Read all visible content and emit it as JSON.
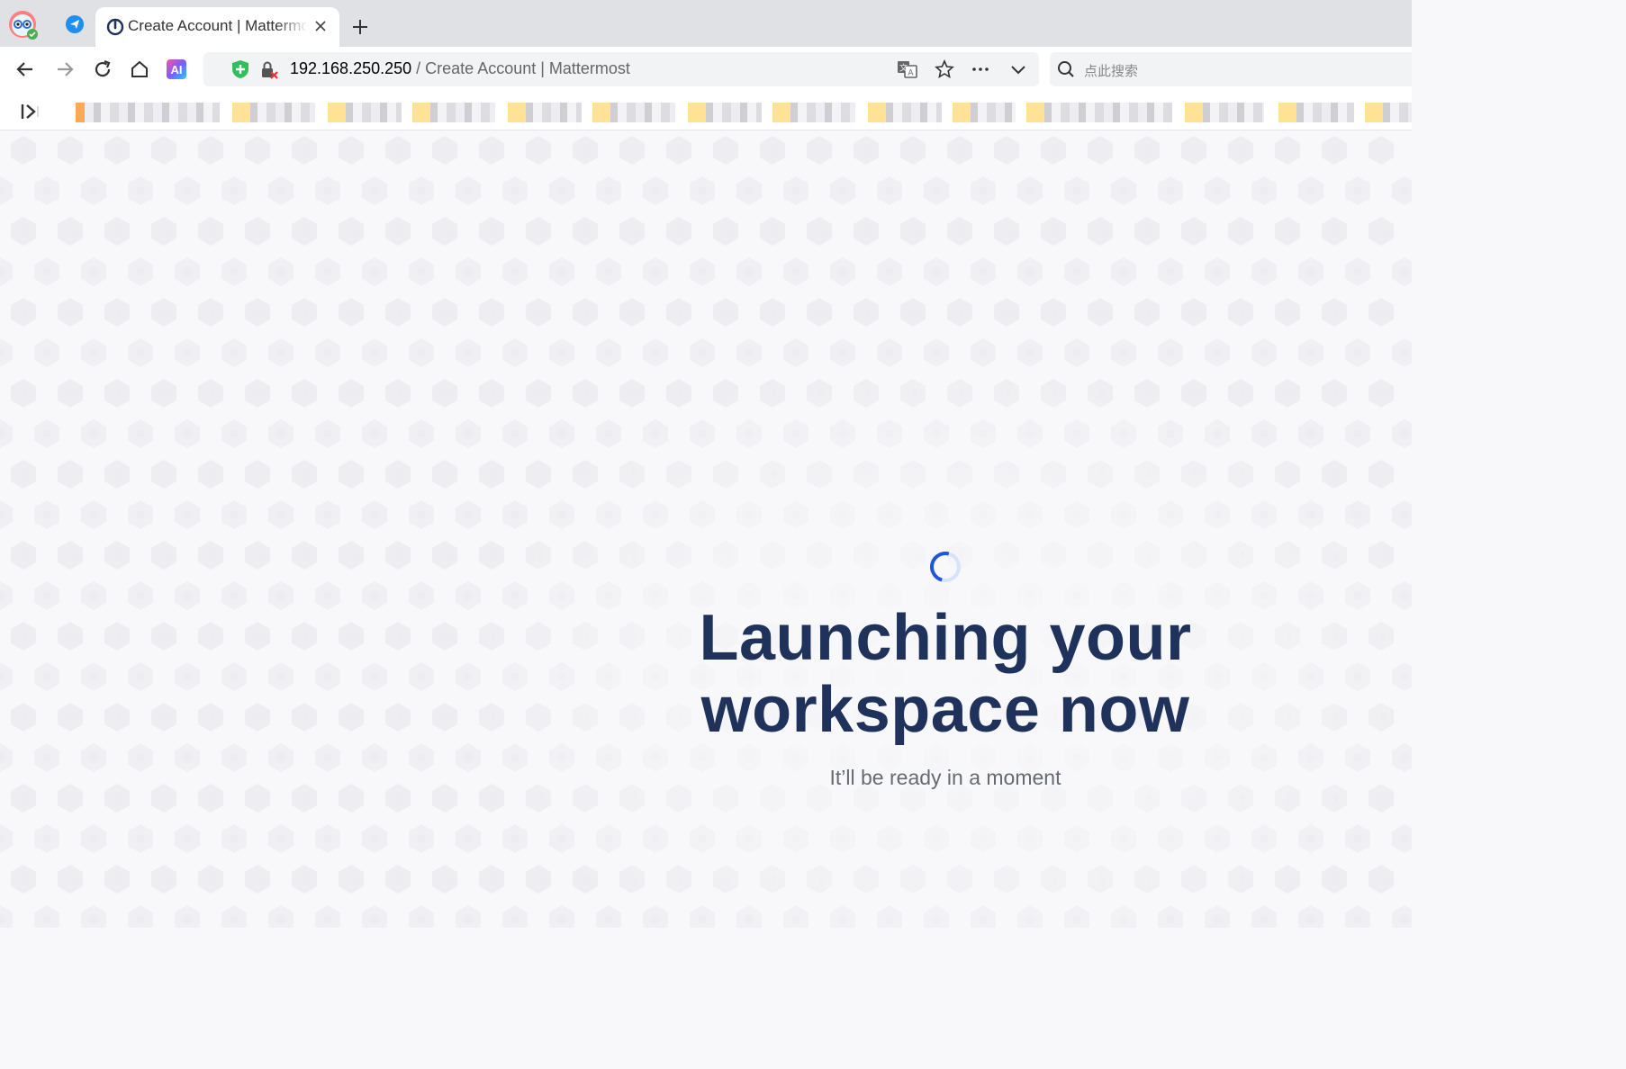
{
  "browser": {
    "tabs": [
      {
        "title": "Create Account | Mattermost",
        "active": true
      }
    ],
    "address_bar": {
      "host": "192.168.250.250",
      "separator": " / ",
      "page_title": "Create Account | Mattermost"
    },
    "search": {
      "placeholder": "点此搜索"
    },
    "toolbar_icons": [
      "back-icon",
      "forward-icon",
      "reload-icon",
      "home-icon",
      "ai-icon",
      "shield-icon",
      "insecure-lock-icon",
      "translate-icon",
      "star-icon",
      "more-icon",
      "chevron-down-icon",
      "search-icon"
    ]
  },
  "main": {
    "headline_line1": "Launching your",
    "headline_line2": "workspace now",
    "subtitle": "It’ll be ready in a moment"
  },
  "colors": {
    "headline": "#1e325c",
    "spinner": "#1c58d9",
    "background": "#f8f8fa"
  }
}
